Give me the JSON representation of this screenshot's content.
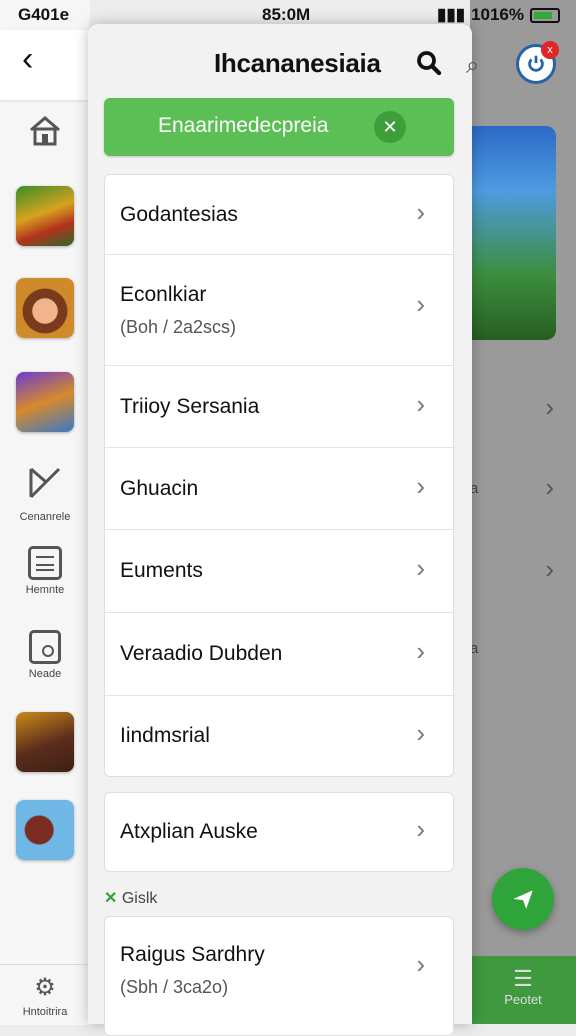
{
  "status_bar": {
    "left_text": "G401e",
    "time": "85:0M",
    "battery_text": "1016%"
  },
  "colors": {
    "accent_green": "#5cbf55",
    "fab_green": "#2ea43a",
    "badge_red": "#e02626"
  },
  "header": {
    "title": "Ihcananesiaia",
    "search_icon": "search-icon"
  },
  "banner": {
    "text": "Enaarimedecpreia",
    "close_icon": "close-icon"
  },
  "menu_group_1": [
    {
      "label": "Godantesias",
      "sub": ""
    },
    {
      "label": "Econlkiar",
      "sub": "(Boh / 2a2scs)"
    },
    {
      "label": "Triioy Sersania",
      "sub": ""
    },
    {
      "label": "Ghuacin",
      "sub": ""
    },
    {
      "label": "Euments",
      "sub": ""
    },
    {
      "label": "Veraadio Dubden",
      "sub": ""
    },
    {
      "label": "Iindmsrial",
      "sub": ""
    }
  ],
  "menu_group_2": [
    {
      "label": "Atxplian Auske"
    }
  ],
  "section_label": "Gislk",
  "menu_group_3": [
    {
      "label": "Raigus Sardhry",
      "sub": "(Sbh / 3ca2o)"
    }
  ],
  "sidebar": {
    "labels": [
      "Cenanrele",
      "Hemnte",
      "Neade"
    ],
    "bottom_label": "Hntoitrira"
  },
  "background_app": {
    "fragments": [
      "a",
      "a"
    ],
    "bottom_label": "Peotet",
    "avatar_badge": "x"
  }
}
